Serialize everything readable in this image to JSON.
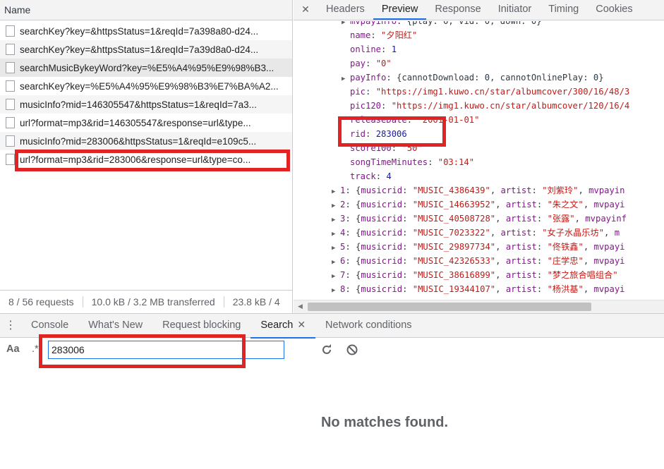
{
  "network": {
    "column_header": "Name",
    "requests": [
      {
        "name": "searchKey?key=&httpsStatus=1&reqId=7a398a80-d24..."
      },
      {
        "name": "searchKey?key=&httpsStatus=1&reqId=7a39d8a0-d24..."
      },
      {
        "name": "searchMusicBykeyWord?key=%E5%A4%95%E9%98%B3..."
      },
      {
        "name": "searchKey?key=%E5%A4%95%E9%98%B3%E7%BA%A2..."
      },
      {
        "name": "musicInfo?mid=146305547&httpsStatus=1&reqId=7a3..."
      },
      {
        "name": "url?format=mp3&rid=146305547&response=url&type..."
      },
      {
        "name": "musicInfo?mid=283006&httpsStatus=1&reqId=e109c5..."
      },
      {
        "name": "url?format=mp3&rid=283006&response=url&type=co..."
      }
    ],
    "status": {
      "requests": "8 / 56 requests",
      "transferred": "10.0 kB / 3.2 MB transferred",
      "resources": "23.8 kB / 4"
    }
  },
  "preview": {
    "close_icon": "close-icon",
    "tabs": [
      "Headers",
      "Preview",
      "Response",
      "Initiator",
      "Timing",
      "Cookies"
    ],
    "active_tab": "Preview",
    "lines": [
      {
        "key": "mvpayinfo",
        "value": "{play: 0, vid: 0, down: 0}",
        "kind": "p",
        "arrow": true
      },
      {
        "key": "name",
        "value": "\"夕阳红\"",
        "kind": "s"
      },
      {
        "key": "online",
        "value": "1",
        "kind": "n"
      },
      {
        "key": "pay",
        "value": "\"0\"",
        "kind": "s"
      },
      {
        "key": "payInfo",
        "value": "{cannotDownload: 0, cannotOnlinePlay: 0}",
        "kind": "p",
        "arrow": true
      },
      {
        "key": "pic",
        "value": "\"https://img1.kuwo.cn/star/albumcover/300/16/48/3",
        "kind": "s"
      },
      {
        "key": "pic120",
        "value": "\"https://img1.kuwo.cn/star/albumcover/120/16/4",
        "kind": "s"
      },
      {
        "key": "releaseDate",
        "value": "\"2001-01-01\"",
        "kind": "s"
      },
      {
        "key": "rid",
        "value": "283006",
        "kind": "n"
      },
      {
        "key": "score100",
        "value": "\"50\"",
        "kind": "s"
      },
      {
        "key": "songTimeMinutes",
        "value": "\"03:14\"",
        "kind": "s"
      },
      {
        "key": "track",
        "value": "4",
        "kind": "n"
      }
    ],
    "items": [
      {
        "index": "1",
        "musicrid": "\"MUSIC_4386439\"",
        "artist": "\"刘紫玲\"",
        "tail": "mvpayin"
      },
      {
        "index": "2",
        "musicrid": "\"MUSIC_14663952\"",
        "artist": "\"朱之文\"",
        "tail": "mvpayi"
      },
      {
        "index": "3",
        "musicrid": "\"MUSIC_40508728\"",
        "artist": "\"张露\"",
        "tail": "mvpayinf"
      },
      {
        "index": "4",
        "musicrid": "\"MUSIC_7023322\"",
        "artist": "\"女子水晶乐坊\"",
        "tail": "m"
      },
      {
        "index": "5",
        "musicrid": "\"MUSIC_29897734\"",
        "artist": "\"佟铁鑫\"",
        "tail": "mvpayi"
      },
      {
        "index": "6",
        "musicrid": "\"MUSIC_42326533\"",
        "artist": "\"庄学忠\"",
        "tail": "mvpayi"
      },
      {
        "index": "7",
        "musicrid": "\"MUSIC_38616899\"",
        "artist": "\"梦之旅合唱组合\"",
        "tail": ""
      },
      {
        "index": "8",
        "musicrid": "\"MUSIC_19344107\"",
        "artist": "\"杨洪基\"",
        "tail": "mvpayi"
      }
    ]
  },
  "drawer": {
    "menu_icon": "more-vert-icon",
    "tabs": [
      {
        "label": "Console"
      },
      {
        "label": "What's New"
      },
      {
        "label": "Request blocking"
      },
      {
        "label": "Search",
        "closable": true
      },
      {
        "label": "Network conditions"
      }
    ],
    "active_tab": "Search",
    "search": {
      "match_case_label": "Aa",
      "regex_label": ".*",
      "value": "283006"
    },
    "empty_message": "No matches found."
  },
  "colors": {
    "annotation": "#e02424",
    "accent": "#1a73e8",
    "json_key": "#881391",
    "json_string": "#c41a16",
    "json_number": "#1a1aa6"
  }
}
